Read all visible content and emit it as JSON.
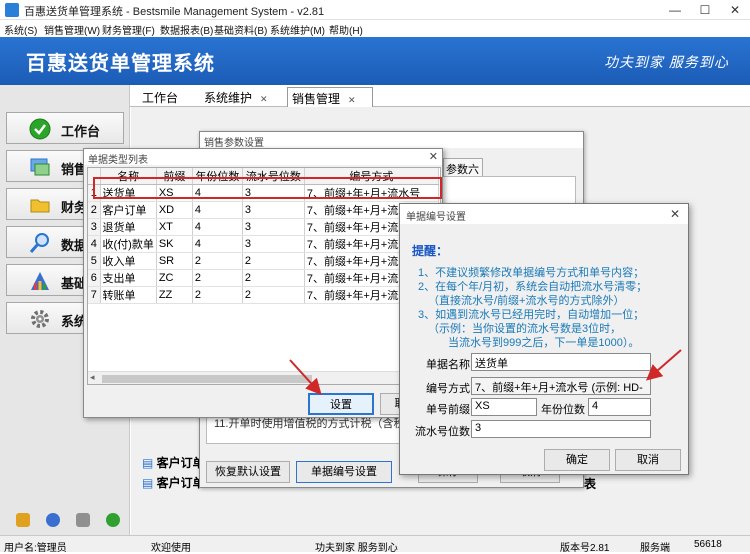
{
  "window": {
    "title": "百惠送货单管理系统 - Bestsmile Management System - v2.81",
    "min": "—",
    "max": "☐",
    "close": "✕"
  },
  "menu": [
    "系统(S)",
    "销售管理(W)",
    "财务管理(F)",
    "数据报表(B)",
    "基础资料(B)",
    "系统维护(M)",
    "帮助(H)"
  ],
  "banner": {
    "title": "百惠送货单管理系统",
    "slogan": "功夫到家 服务到心"
  },
  "sidebar": {
    "items": [
      {
        "label": "工作台",
        "icon": "check-circle-icon",
        "color": "#2aa52a"
      },
      {
        "label": "销售管",
        "icon": "sales-window-icon",
        "color": "#2a74d2"
      },
      {
        "label": "财务管",
        "icon": "folder-icon",
        "color": "#f0c030"
      },
      {
        "label": "数据报",
        "icon": "magnifier-icon",
        "color": "#2a74d2"
      },
      {
        "label": "基础资",
        "icon": "building-icon",
        "color": "#d04040"
      },
      {
        "label": "系统维",
        "icon": "gear-icon",
        "color": "#707070"
      }
    ]
  },
  "tabs": [
    {
      "label": "工作台",
      "close": ""
    },
    {
      "label": "系统维护",
      "close": "✕"
    },
    {
      "label": "销售管理",
      "close": "✕"
    }
  ],
  "sales_dialog": {
    "title": "销售参数设置",
    "tab_visible": "参数六",
    "partial_text": "11.开单时使用增值税的方式计税（含税方",
    "btn_restore": "恢复默认设置",
    "btn_numbering": "单据编号设置",
    "btn_save_partial": "保存",
    "btn_cancel_partial": "取消",
    "bottom_partial_1": "客户订单",
    "bottom_partial_2": "客户订单",
    "bottom_partial_3": "表"
  },
  "types_dialog": {
    "title": "单据类型列表",
    "columns": [
      "",
      "名称",
      "前缀",
      "年份位数",
      "流水号位数",
      "编号方式"
    ],
    "rows": [
      [
        "1",
        "送货单",
        "XS",
        "4",
        "3",
        "7、前缀+年+月+流水号"
      ],
      [
        "2",
        "客户订单",
        "XD",
        "4",
        "3",
        "7、前缀+年+月+流水号"
      ],
      [
        "3",
        "退货单",
        "XT",
        "4",
        "3",
        "7、前缀+年+月+流水号"
      ],
      [
        "4",
        "收(付)款单",
        "SK",
        "4",
        "3",
        "7、前缀+年+月+流水号"
      ],
      [
        "5",
        "收入单",
        "SR",
        "2",
        "2",
        "7、前缀+年+月+流水号"
      ],
      [
        "6",
        "支出单",
        "ZC",
        "2",
        "2",
        "7、前缀+年+月+流水号"
      ],
      [
        "7",
        "转账单",
        "ZZ",
        "2",
        "2",
        "7、前缀+年+月+流水号"
      ]
    ],
    "btn_setup": "设置",
    "btn_partial": "取"
  },
  "numbering_dialog": {
    "title": "单据编号设置",
    "close": "✕",
    "heading": "提醒：",
    "lines": [
      "1、不建议频繁修改单据编号方式和单号内容；",
      "2、在每个年/月初，系统会自动把流水号清零；",
      "（直接流水号/前缀+流水号的方式除外）",
      "3、如遇到流水号已经用完时，自动增加一位；",
      "（示例：当你设置的流水号数是3位时，",
      "当流水号到999之后，下一单是1000）。"
    ],
    "lbl_name": "单据名称",
    "val_name": "送货单",
    "lbl_mode": "编号方式",
    "val_mode": "7、前缀+年+月+流水号 (示例: HD-",
    "lbl_prefix": "单号前缀",
    "val_prefix": "XS",
    "lbl_year": "年份位数",
    "val_year": "4",
    "lbl_serial": "流水号位数",
    "val_serial": "3",
    "btn_ok": "确定",
    "btn_cancel": "取消"
  },
  "statusbar": {
    "user": "用户名:管理员",
    "welcome": "欢迎使用",
    "slogan": "功夫到家 服务到心",
    "version": "版本号2.81",
    "side": "服务端",
    "port": "56618"
  }
}
